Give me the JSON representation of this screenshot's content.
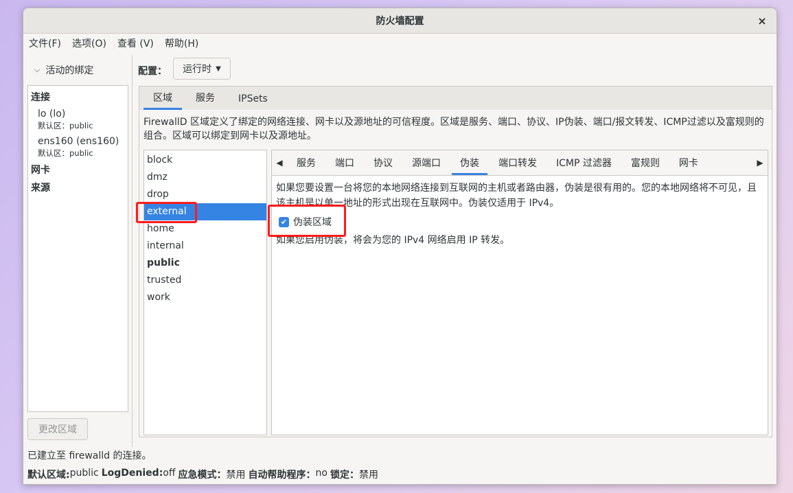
{
  "window": {
    "title": "防火墙配置",
    "close_glyph": "×"
  },
  "menu": [
    "文件(F)",
    "选项(O)",
    "查看 (V)",
    "帮助(H)"
  ],
  "left": {
    "header": "活动的绑定",
    "connections_label": "连接",
    "connections": [
      {
        "name": "lo (lo)",
        "zone": "默认区：public"
      },
      {
        "name": "ens160 (ens160)",
        "zone": "默认区：public"
      }
    ],
    "nic_label": "网卡",
    "source_label": "来源",
    "change_zone_button": "更改区域"
  },
  "config": {
    "label": "配置：",
    "mode": "运行时"
  },
  "main_tabs": [
    "区域",
    "服务",
    "IPSets"
  ],
  "zone_description": "FirewallD 区域定义了绑定的网络连接、网卡以及源地址的可信程度。区域是服务、端口、协议、IP伪装、端口/报文转发、ICMP过滤以及富规则的组合。区域可以绑定到网卡以及源地址。",
  "zones": [
    "block",
    "dmz",
    "drop",
    "external",
    "home",
    "internal",
    "public",
    "trusted",
    "work"
  ],
  "selected_zone": "external",
  "default_zone": "public",
  "sub_tabs": [
    "服务",
    "端口",
    "协议",
    "源端口",
    "伪装",
    "端口转发",
    "ICMP 过滤器",
    "富规则",
    "网卡"
  ],
  "active_sub_tab": "伪装",
  "masquerade": {
    "description": "如果您要设置一台将您的本地网络连接到互联网的主机或者路由器，伪装是很有用的。您的本地网络将不可见，且该主机是以单一地址的形式出现在互联网中。伪装仅适用于 IPv4。",
    "checkbox_label": "伪装区域",
    "checked": true,
    "note": "如果您启用伪装，将会为您的 IPv4 网络启用 IP 转发。"
  },
  "status": {
    "connection": "已建立至 firewalld 的连接。",
    "default_zone_label": "默认区域:",
    "default_zone_value": "public",
    "log_denied_label": "LogDenied:",
    "log_denied_value": "off",
    "panic_label": "应急模式：",
    "panic_value": "禁用",
    "helper_label": "自动帮助程序：",
    "helper_value": "no",
    "lock_label": "锁定：",
    "lock_value": "禁用"
  },
  "colors": {
    "accent": "#3584e4",
    "highlight": "#ff1a1a"
  }
}
